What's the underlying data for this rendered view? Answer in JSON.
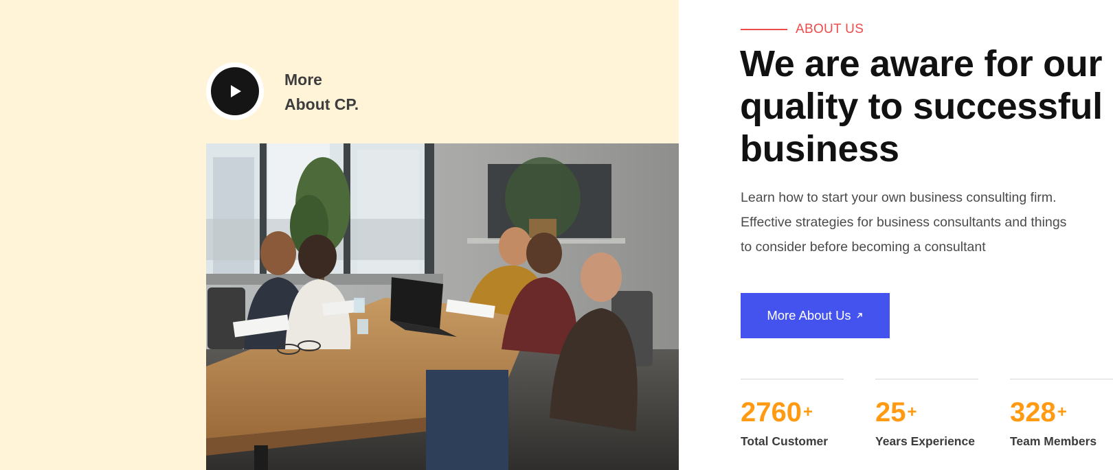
{
  "video": {
    "label_line1": "More",
    "label_line2": "About CP."
  },
  "about": {
    "tag": "ABOUT US",
    "headline_line1": "We are aware for our",
    "headline_line2": "quality to successful",
    "headline_line3": "business",
    "description_line1": "Learn how to start your own business consulting firm.",
    "description_line2": "Effective strategies for business consultants and things",
    "description_line3": "to consider before becoming a consultant",
    "cta_label": "More About Us"
  },
  "stats": [
    {
      "value": "2760",
      "suffix": "+",
      "label": "Total Customer"
    },
    {
      "value": "25",
      "suffix": "+",
      "label": "Years Experience"
    },
    {
      "value": "328",
      "suffix": "+",
      "label": "Team Members"
    }
  ],
  "colors": {
    "left_bg": "#fff4d8",
    "accent_red": "#ee4b4b",
    "button_blue": "#4553ee",
    "stat_orange": "#ff9a12"
  },
  "icons": {
    "play": "play-icon",
    "cta_arrow": "arrow-up-right-icon"
  }
}
